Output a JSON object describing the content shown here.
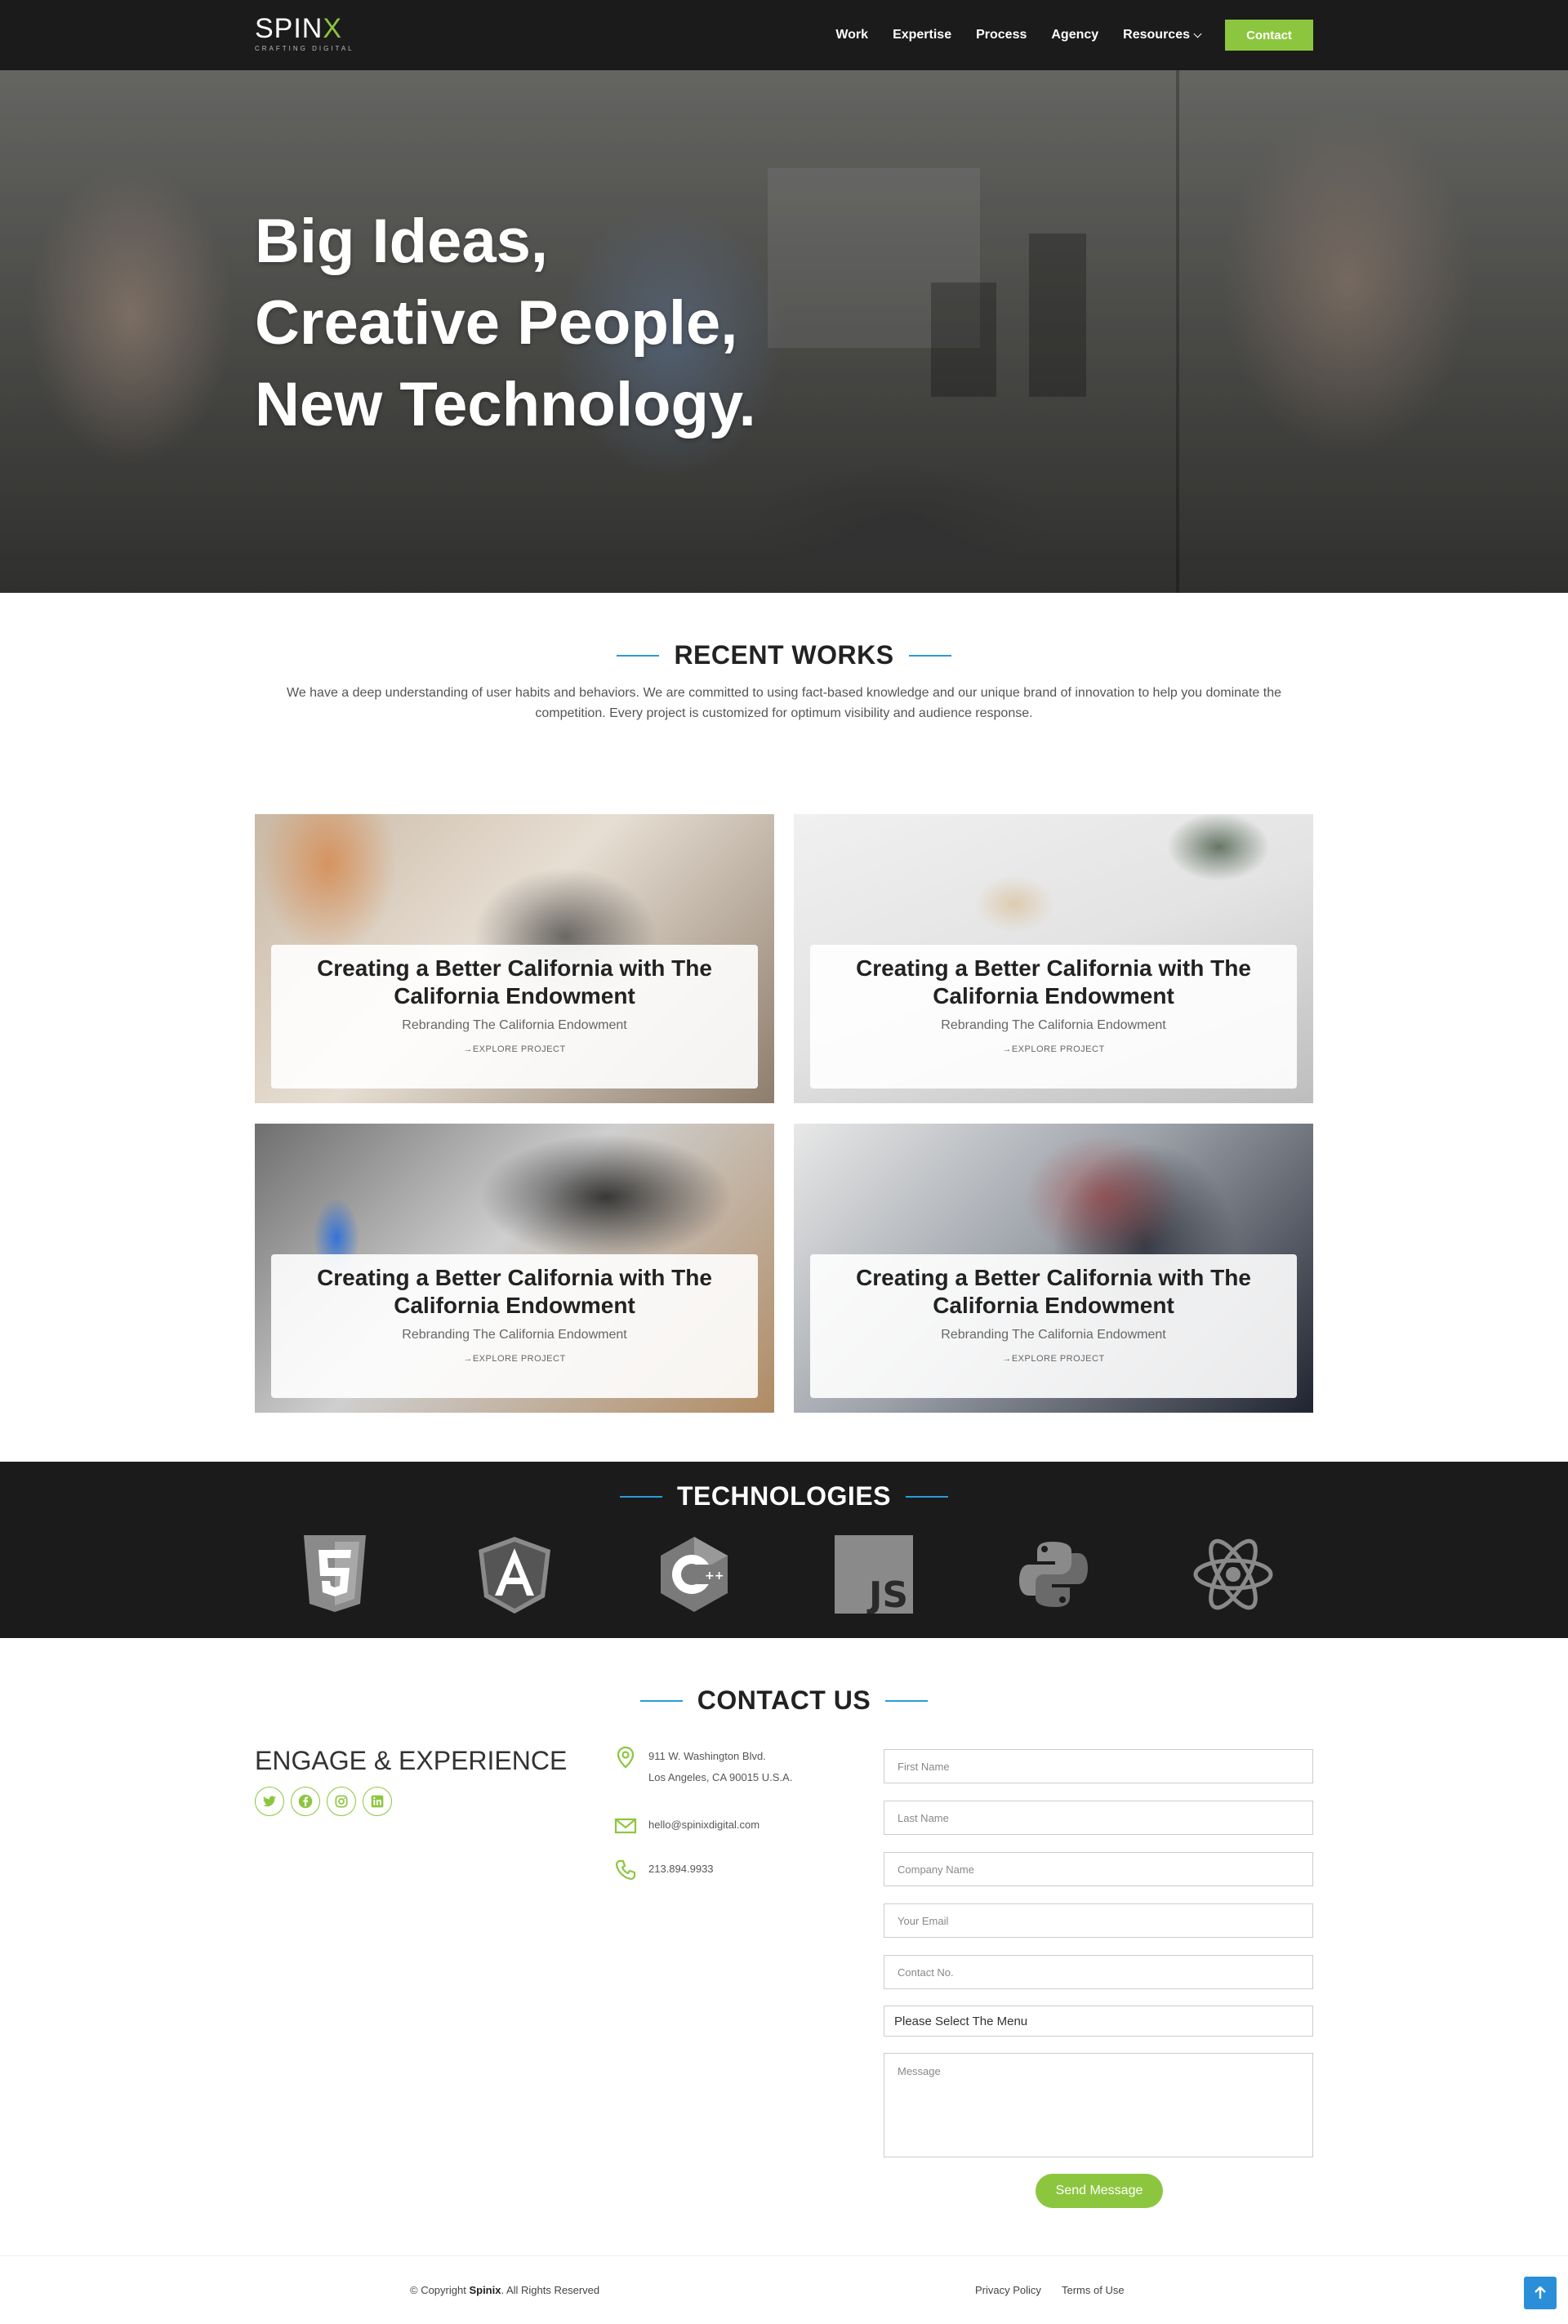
{
  "header": {
    "logo_text": "SPIN",
    "logo_x": "X",
    "logo_tagline": "CRAFTING DIGITAL",
    "nav": [
      {
        "label": "Work"
      },
      {
        "label": "Expertise"
      },
      {
        "label": "Process"
      },
      {
        "label": "Agency"
      },
      {
        "label": "Resources"
      }
    ],
    "contact_button": "Contact"
  },
  "hero": {
    "title_line1": "Big Ideas,",
    "title_line2": "Creative People,",
    "title_line3": "New Technology."
  },
  "recent_works": {
    "heading": "RECENT WORKS",
    "description": "We have a deep understanding of user habits and behaviors. We are committed to using fact-based knowledge and our unique brand of innovation to help you dominate the competition. Every project is customized for optimum visibility and audience response.",
    "projects": [
      {
        "title": "Creating a Better California with The California Endowment",
        "subtitle": "Rebranding The California Endowment",
        "link": "EXPLORE PROJECT"
      },
      {
        "title": "Creating a Better California with The California Endowment",
        "subtitle": "Rebranding The California Endowment",
        "link": "EXPLORE PROJECT"
      },
      {
        "title": "Creating a Better California with The California Endowment",
        "subtitle": "Rebranding The California Endowment",
        "link": "EXPLORE PROJECT"
      },
      {
        "title": "Creating a Better California with The California Endowment",
        "subtitle": "Rebranding The California Endowment",
        "link": "EXPLORE PROJECT"
      }
    ]
  },
  "technologies": {
    "heading": "TECHNOLOGIES",
    "icons": [
      "html5-icon",
      "angular-icon",
      "cplusplus-icon",
      "javascript-icon",
      "python-icon",
      "react-icon"
    ]
  },
  "contact": {
    "heading": "CONTACT US",
    "engage": "ENGAGE & EXPERIENCE",
    "socials": [
      "twitter-icon",
      "facebook-icon",
      "instagram-icon",
      "linkedin-icon"
    ],
    "address_line1": "911 W. Washington Blvd.",
    "address_line2": "Los Angeles, CA 90015 U.S.A.",
    "email": "hello@spinixdigital.com",
    "phone": "213.894.9933",
    "form": {
      "first_name": "First Name",
      "last_name": "Last Name",
      "company": "Company Name",
      "email": "Your Email",
      "contact_no": "Contact No.",
      "select": "Please Select The Menu",
      "message": "Message",
      "submit": "Send Message"
    }
  },
  "footer": {
    "copyright_pre": "© Copyright ",
    "copyright_brand": "Spinix",
    "copyright_post": ". All Rights Reserved",
    "privacy": "Privacy Policy",
    "terms": "Terms of Use"
  },
  "colors": {
    "accent_green": "#8cc63f",
    "accent_blue": "#2a9ad8",
    "dark_bg": "#1b1b1b"
  }
}
